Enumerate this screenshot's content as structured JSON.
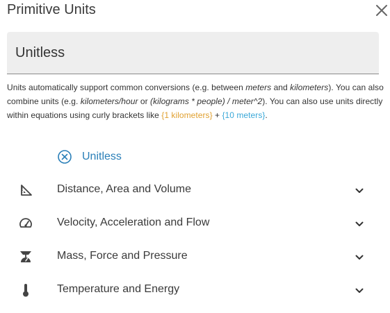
{
  "dialog": {
    "title": "Primitive Units",
    "close_icon": "close-icon"
  },
  "search": {
    "value": "Unitless"
  },
  "help": {
    "p1": "Units automatically support common conversions (e.g. between ",
    "e1": "meters",
    "p2": " and ",
    "e2": "kilometers",
    "p3": "). You can also combine units (e.g. ",
    "e3": "kilometers/hour",
    "p4": " or ",
    "e4": "(kilograms * people) / meter^2",
    "p5": "). You can also use units directly within equations using curly brackets like ",
    "tok1": "{1 kilometers}",
    "p6": " + ",
    "tok2": "{10 meters}",
    "p7": "."
  },
  "colors": {
    "token_1": "#e0a030",
    "token_2": "#3aa8d8",
    "selected": "#2a7fb8"
  },
  "selected_unit": {
    "label": "Unitless",
    "icon": "clear-circle-icon"
  },
  "categories": [
    {
      "label": "Distance, Area and Volume",
      "icon": "ruler-triangle-icon"
    },
    {
      "label": "Velocity, Acceleration and Flow",
      "icon": "speedometer-icon"
    },
    {
      "label": "Mass, Force and Pressure",
      "icon": "scale-icon"
    },
    {
      "label": "Temperature and Energy",
      "icon": "thermometer-icon"
    }
  ]
}
